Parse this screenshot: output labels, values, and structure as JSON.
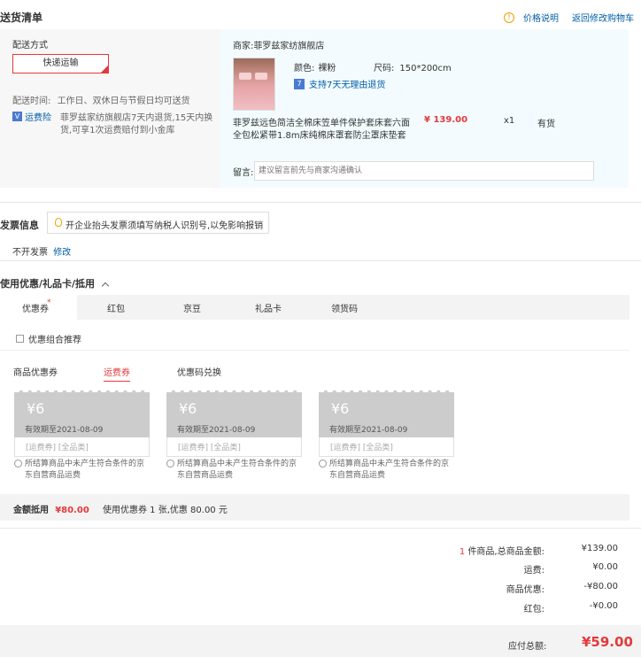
{
  "header": {
    "title": "送货清单",
    "price_note": "价格说明",
    "return_cart": "返回修改购物车"
  },
  "delivery": {
    "method_label": "配送方式",
    "method_value": "快递运输",
    "time_label": "配送时间:",
    "time_value": "工作日、双休日与节假日均可送货",
    "freight_tag": "运费险",
    "freight_text_1": "菲罗兹家纺旗舰店7天内退货,15天内换",
    "freight_text_2": "货,可享1次运费赔付到小金库"
  },
  "product": {
    "merchant": "商家:菲罗兹家纺旗舰店",
    "color_label": "颜色:",
    "color_value": "裸粉",
    "size_label": "尺码:",
    "size_value": "150*200cm",
    "return_badge": "支持7天无理由退货",
    "name_1": "菲罗兹远色简洁全棉床笠单件保护套床套六面",
    "name_2": "全包松紧带1.8m床纯棉床罩套防尘罩床垫套",
    "price": "¥ 139.00",
    "qty": "x1",
    "stock": "有货",
    "remark_label": "留言:",
    "remark_placeholder": "建议留言前先与商家沟通确认"
  },
  "invoice": {
    "title": "发票信息",
    "tip": "开企业抬头发票须填写纳税人识别号,以免影响报销",
    "value": "不开发票",
    "edit": "修改"
  },
  "discount": {
    "title": "使用优惠/礼品卡/抵用",
    "tabs": [
      "优惠券",
      "红包",
      "京豆",
      "礼品卡",
      "领货码"
    ],
    "combo": "优惠组合推荐",
    "subtabs": [
      "商品优惠券",
      "运费券",
      "优惠码兑换"
    ],
    "coupons": [
      {
        "amount": "¥6",
        "expiry": "有效期至2021-08-09",
        "tags": "[运费券] [全品类]",
        "note_1": "所结算商品中未产生符合条件的京",
        "note_2": "东自营商品运费"
      },
      {
        "amount": "¥6",
        "expiry": "有效期至2021-08-09",
        "tags": "[运费券] [全品类]",
        "note_1": "所结算商品中未产生符合条件的京",
        "note_2": "东自营商品运费"
      },
      {
        "amount": "¥6",
        "expiry": "有效期至2021-08-09",
        "tags": "[运费券] [全品类]",
        "note_1": "所结算商品中未产生符合条件的京",
        "note_2": "东自营商品运费"
      }
    ],
    "deduct_label": "金额抵用",
    "deduct_value": "¥80.00",
    "deduct_desc": "使用优惠券 1 张,优惠 80.00 元"
  },
  "summary": {
    "count": "1",
    "count_suffix": "件商品,总商品金额:",
    "total": "¥139.00",
    "shipping_label": "运费:",
    "shipping": "¥0.00",
    "discount_label": "商品优惠:",
    "discount": "-¥80.00",
    "redpack_label": "红包:",
    "redpack": "-¥0.00",
    "payable_label": "应付总额:",
    "payable": "¥59.00"
  },
  "colors": {
    "accent": "#e4393c",
    "link": "#005ea7",
    "panel": "#f7f7f7",
    "panel_blue": "#f3fbfe"
  }
}
